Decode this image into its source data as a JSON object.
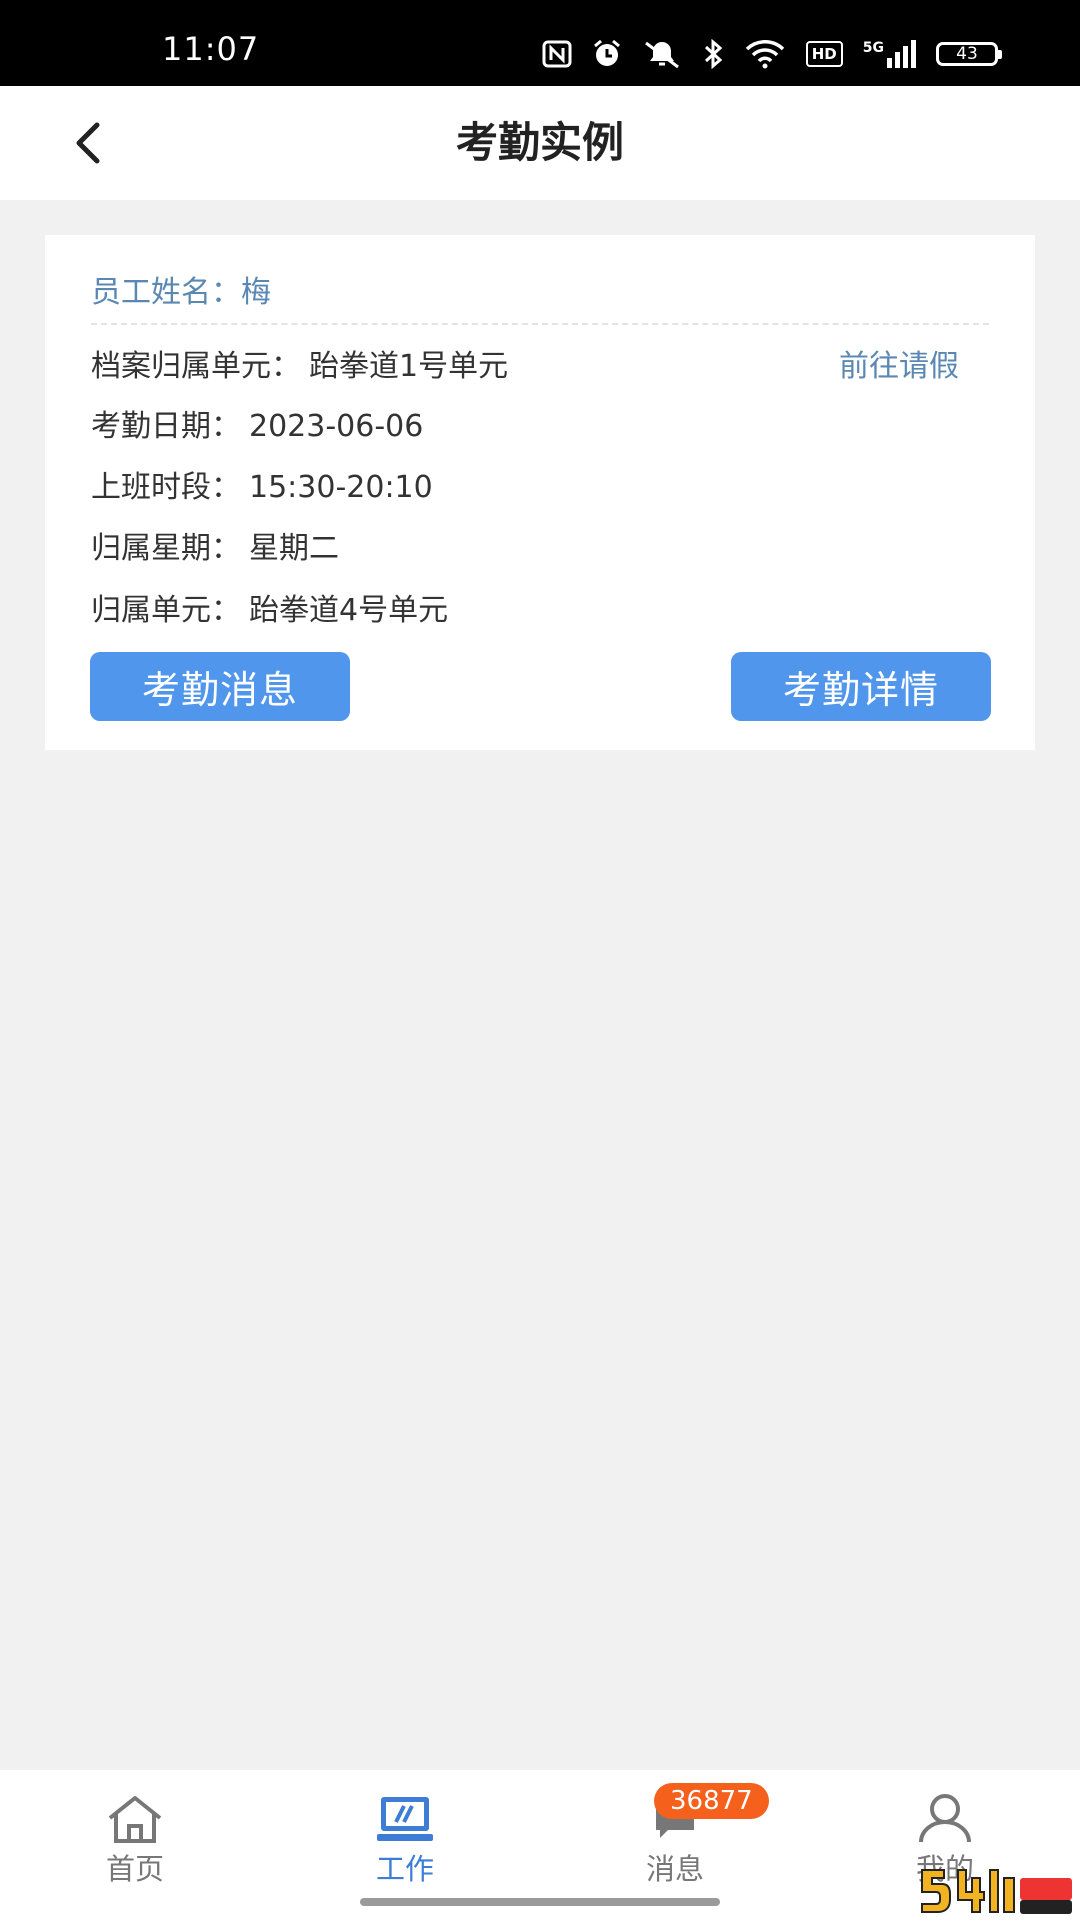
{
  "status_bar": {
    "time": "11:07",
    "battery": "43",
    "network_label": "5G",
    "hd_label": "HD",
    "icons": [
      "nfc-icon",
      "alarm-icon",
      "mute-icon",
      "bluetooth-icon",
      "wifi-icon",
      "hd-icon",
      "signal-icon",
      "battery-icon"
    ]
  },
  "header": {
    "title": "考勤实例",
    "back_icon": "chevron-left-icon"
  },
  "card": {
    "employee_label": "员工姓名：",
    "employee_name": "梅",
    "leave_link": "前往请假",
    "rows": [
      {
        "label": "档案归属单元：",
        "value": "跆拳道1号单元"
      },
      {
        "label": "考勤日期：",
        "value": "2023-06-06"
      },
      {
        "label": "上班时段：",
        "value": "15:30-20:10"
      },
      {
        "label": "归属星期：",
        "value": "星期二"
      },
      {
        "label": "归属单元：",
        "value": "跆拳道4号单元"
      }
    ],
    "button_left": "考勤消息",
    "button_right": "考勤详情"
  },
  "bottom_nav": {
    "items": [
      {
        "label": "首页",
        "icon": "home-icon"
      },
      {
        "label": "工作",
        "icon": "work-icon",
        "active": true
      },
      {
        "label": "消息",
        "icon": "message-icon",
        "badge": "36877"
      },
      {
        "label": "我的",
        "icon": "user-icon"
      }
    ]
  },
  "colors": {
    "accent": "#4f96ec",
    "link": "#5b88b3",
    "badge": "#f6601d",
    "background": "#f1f1f1"
  }
}
